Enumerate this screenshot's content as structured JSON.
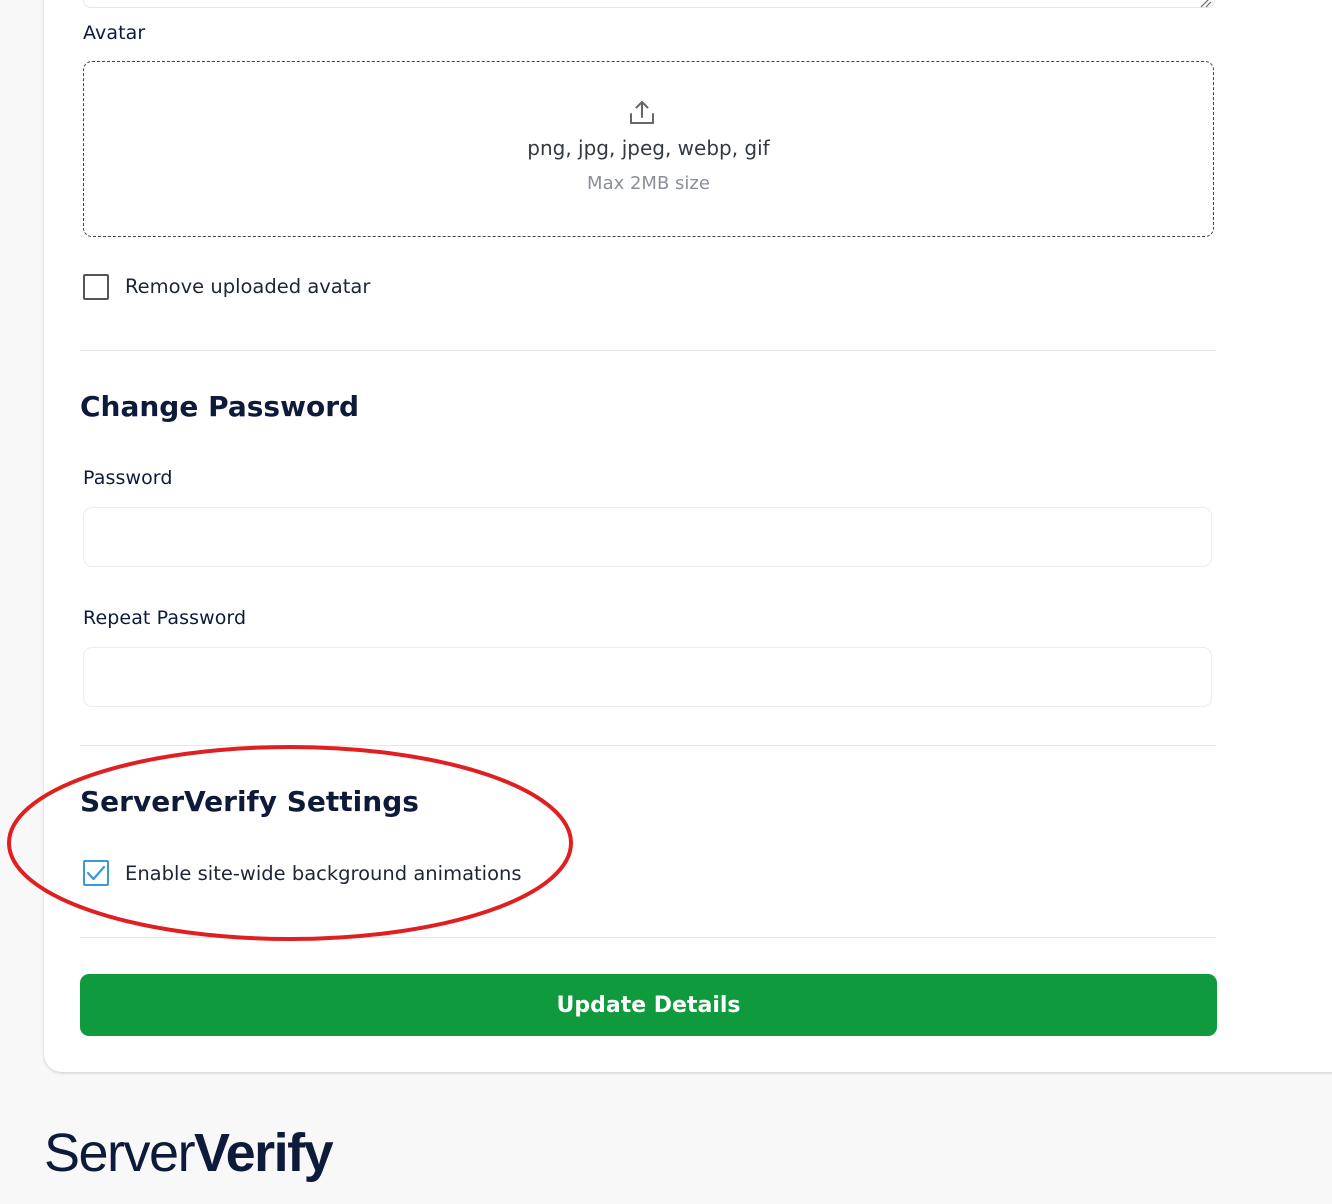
{
  "avatar": {
    "label": "Avatar",
    "dropzone": {
      "icon": "upload-icon",
      "formats": "png, jpg, jpeg, webp, gif",
      "size_note": "Max 2MB size"
    },
    "remove_checkbox": {
      "label": "Remove uploaded avatar",
      "checked": false
    }
  },
  "change_password": {
    "title": "Change Password",
    "password": {
      "label": "Password",
      "value": "",
      "placeholder": ""
    },
    "repeat_password": {
      "label": "Repeat Password",
      "value": "",
      "placeholder": ""
    }
  },
  "serververify_settings": {
    "title": "ServerVerify Settings",
    "animations_checkbox": {
      "label": "Enable site-wide background animations",
      "checked": true
    }
  },
  "actions": {
    "update_label": "Update Details"
  },
  "footer": {
    "brand_light": "Server",
    "brand_bold": "Verify"
  },
  "colors": {
    "primary_text": "#0e1a3a",
    "button_green": "#0f9b3d",
    "checkbox_blue": "#3a9ad9",
    "annotation_red": "#e02020"
  }
}
